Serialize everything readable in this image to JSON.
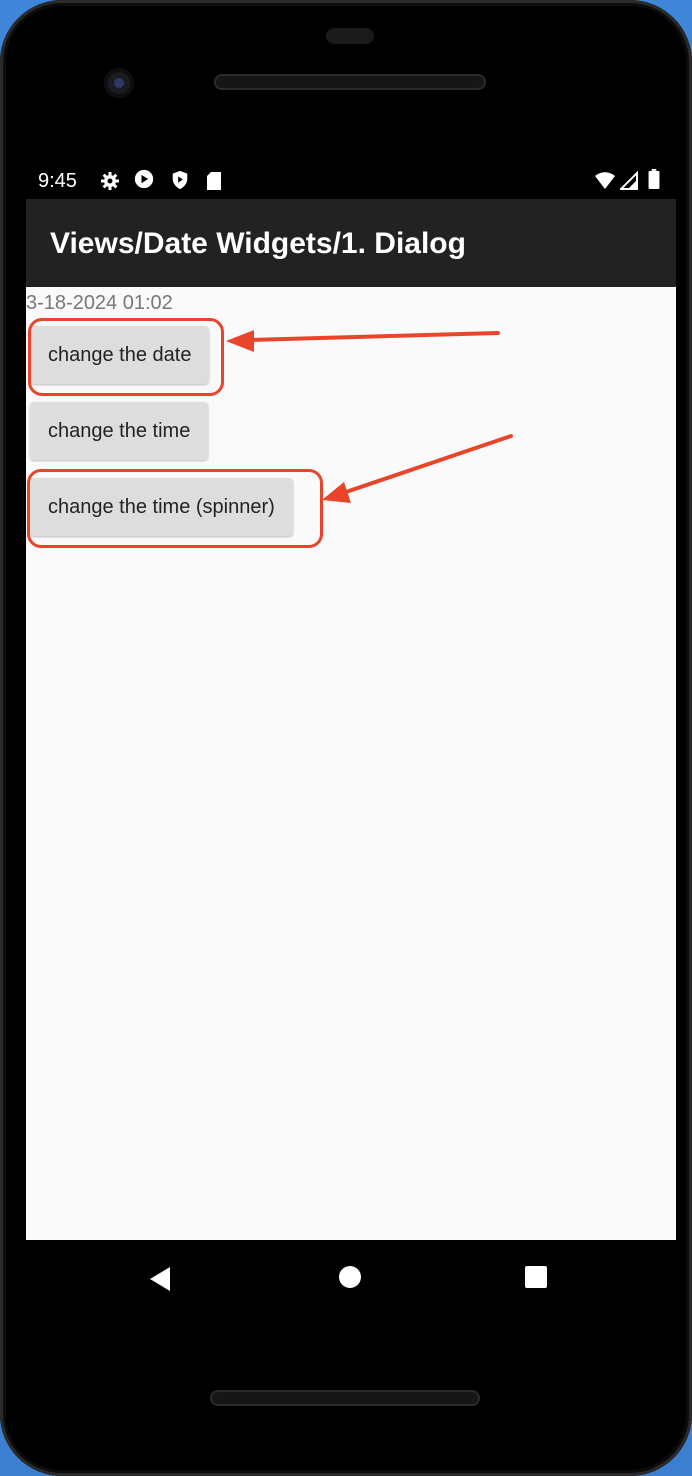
{
  "status_bar": {
    "time": "9:45",
    "left_icons": [
      "gear-icon",
      "play-circle-icon",
      "shield-icon",
      "sd-card-icon"
    ],
    "right_icons": [
      "wifi-icon",
      "cell-signal-icon",
      "battery-icon"
    ]
  },
  "app_bar": {
    "title": "Views/Date Widgets/1. Dialog"
  },
  "content": {
    "date_time_value": "3-18-2024 01:02",
    "buttons": [
      {
        "label": "change the date",
        "highlighted": true
      },
      {
        "label": "change the time",
        "highlighted": false
      },
      {
        "label": "change the time (spinner)",
        "highlighted": true
      }
    ]
  },
  "nav_bar": {
    "buttons": [
      "back-icon",
      "home-icon",
      "recents-icon"
    ]
  },
  "colors": {
    "highlight": "#e8452a",
    "app_bar": "#222222",
    "button": "#dcdddc",
    "screen_bg": "#fafafa"
  }
}
